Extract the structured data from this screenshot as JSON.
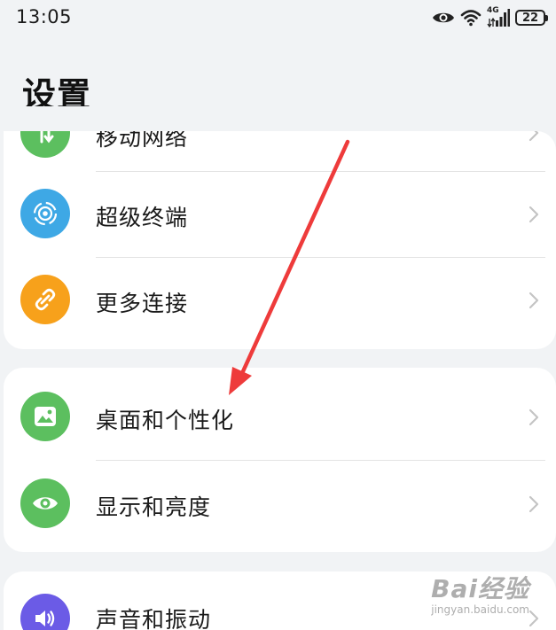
{
  "status_bar": {
    "time": "13:05",
    "network_label": "4G",
    "battery": "22",
    "icons": [
      "eye-icon",
      "wifi-icon",
      "cellular-signal-icon",
      "battery-icon"
    ]
  },
  "page": {
    "title": "设置"
  },
  "groups": [
    {
      "items": [
        {
          "label": "移动网络",
          "icon": "mobile-network-icon",
          "color": "#5cbf5f"
        },
        {
          "label": "超级终端",
          "icon": "super-device-icon",
          "color": "#3ea8e5"
        },
        {
          "label": "更多连接",
          "icon": "link-icon",
          "color": "#f7a11b"
        }
      ]
    },
    {
      "items": [
        {
          "label": "桌面和个性化",
          "icon": "wallpaper-icon",
          "color": "#5cbf5f"
        },
        {
          "label": "显示和亮度",
          "icon": "eye-icon",
          "color": "#5cbf5f"
        }
      ]
    },
    {
      "items": [
        {
          "label": "声音和振动",
          "icon": "speaker-icon",
          "color": "#6b5be6"
        }
      ]
    }
  ],
  "annotation": {
    "arrow_color": "#ee3b3b"
  },
  "watermark": {
    "main": "Bai经验",
    "sub": "jingyan.baidu.com"
  }
}
